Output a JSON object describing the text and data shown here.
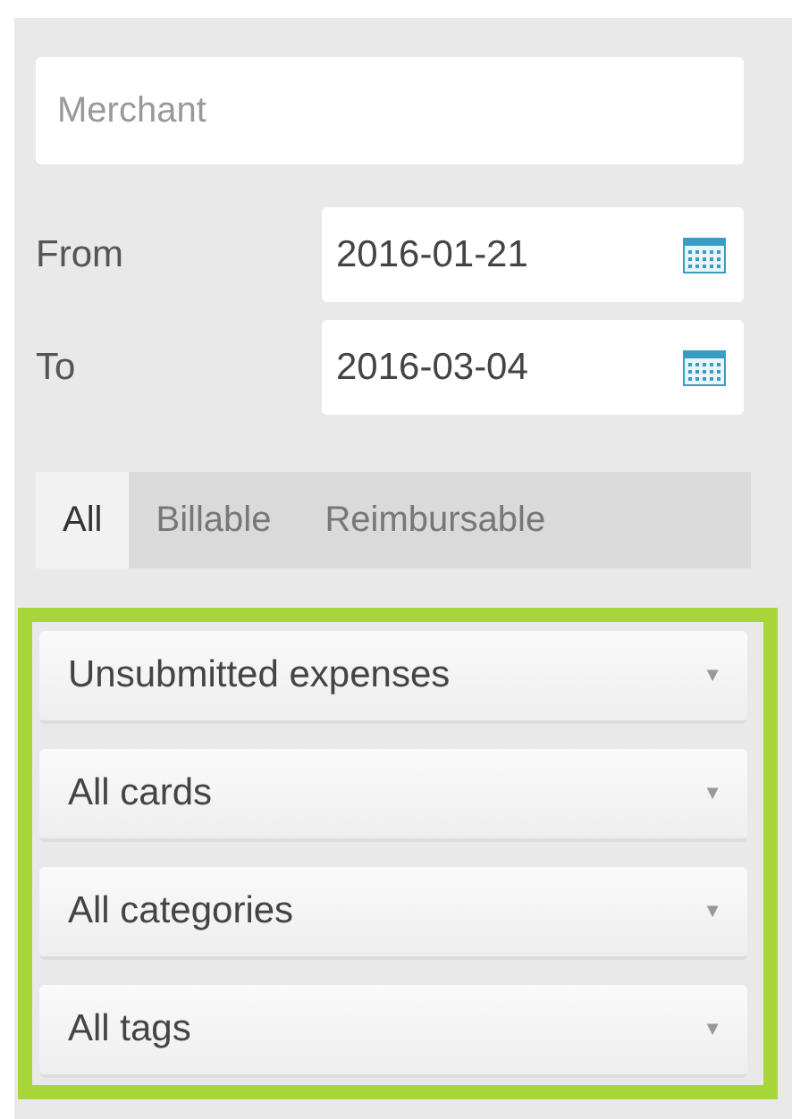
{
  "merchant": {
    "placeholder": "Merchant"
  },
  "dates": [
    {
      "label": "From",
      "value": "2016-01-21"
    },
    {
      "label": "To",
      "value": "2016-03-04"
    }
  ],
  "tabs": [
    {
      "label": "All",
      "selected": true
    },
    {
      "label": "Billable",
      "selected": false
    },
    {
      "label": "Reimbursable",
      "selected": false
    }
  ],
  "filters": [
    {
      "label": "Unsubmitted expenses",
      "arrow": "▼"
    },
    {
      "label": "All cards",
      "arrow": "▼"
    },
    {
      "label": "All categories",
      "arrow": "▼"
    },
    {
      "label": "All tags",
      "arrow": "▼"
    }
  ]
}
